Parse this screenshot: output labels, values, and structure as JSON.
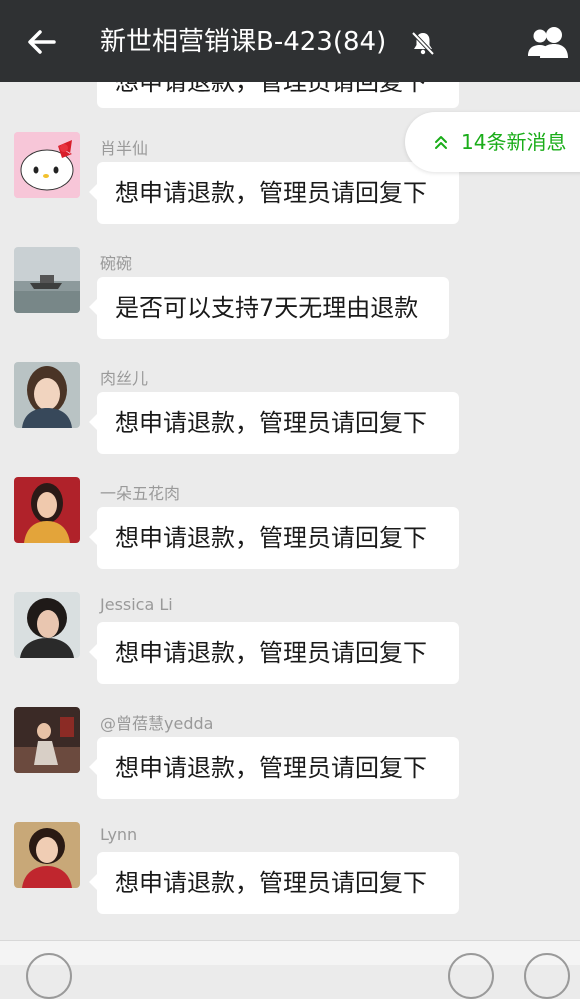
{
  "header": {
    "title": "新世相营销课B-423(84)"
  },
  "chat": {
    "top_partial_text": "想申请退款，管理员请回复下",
    "new_messages_label": "14条新消息",
    "messages": [
      {
        "name": "肖半仙",
        "text": "想申请退款，管理员请回复下"
      },
      {
        "name": "碗碗",
        "text": "是否可以支持7天无理由退款"
      },
      {
        "name": "肉丝儿",
        "text": "想申请退款，管理员请回复下"
      },
      {
        "name": "一朵五花肉",
        "text": "想申请退款，管理员请回复下"
      },
      {
        "name": "Jessica Li",
        "text": "想申请退款，管理员请回复下"
      },
      {
        "name": "@曾蓓慧yedda",
        "text": "想申请退款，管理员请回复下"
      },
      {
        "name": "Lynn",
        "text": "想申请退款，管理员请回复下"
      }
    ]
  },
  "icons": {
    "back": "arrow-left-icon",
    "mute": "bell-off-icon",
    "group": "group-members-icon",
    "new_messages": "double-chevron-up-icon"
  },
  "colors": {
    "header_bg": "#2f3133",
    "chat_bg": "#ebebeb",
    "accent_green": "#1aad19"
  }
}
